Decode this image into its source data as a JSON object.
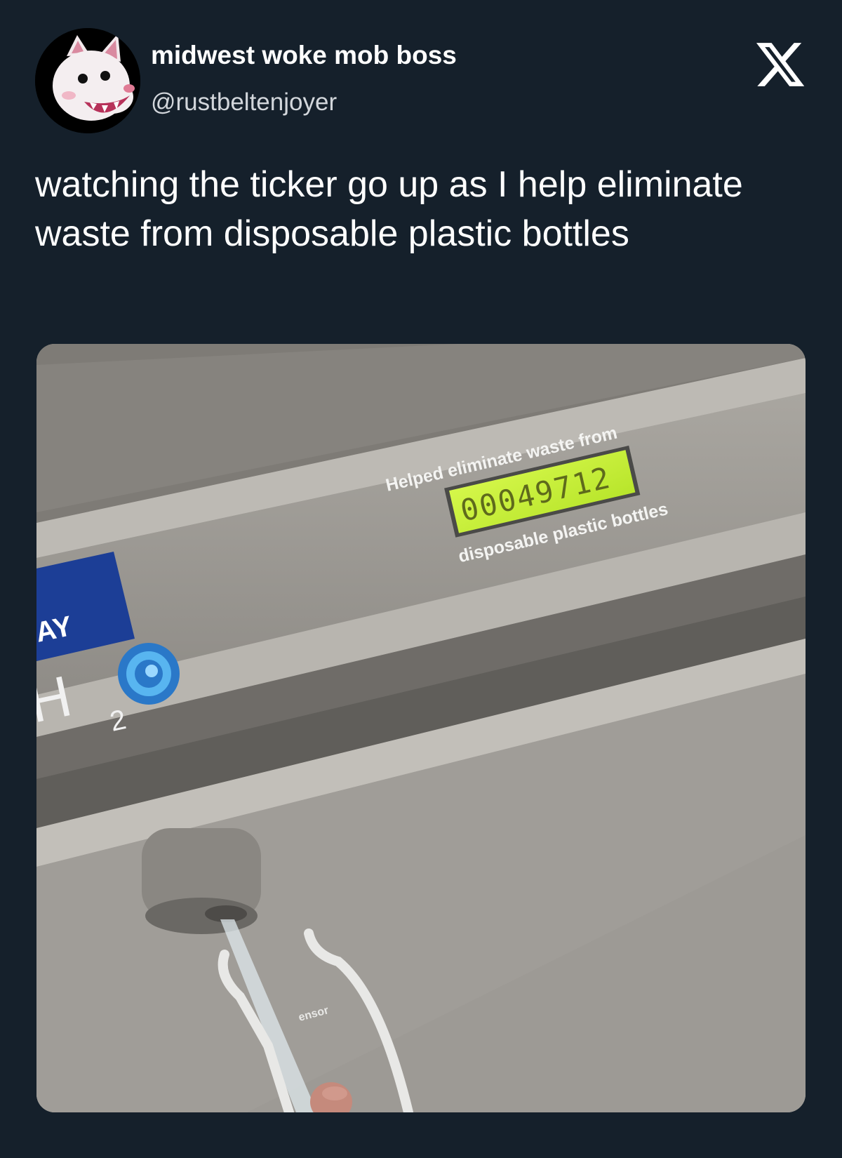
{
  "user": {
    "display_name": "midwest woke mob boss",
    "handle": "@rustbeltenjoyer",
    "avatar_icon": "opossum-avatar-icon"
  },
  "platform": {
    "logo_icon": "x-logo-icon"
  },
  "tweet": {
    "text": "watching the ticker go up as I help eliminate waste from disposable plastic bottles"
  },
  "media": {
    "panel_top_text": "Helped eliminate waste from",
    "counter_value": "00049712",
    "panel_bottom_text": "disposable plastic bottles",
    "brand_fragment": "AY",
    "h2o_label": "H",
    "h2o_subscript": "2",
    "sensor_label": "ensor",
    "lcd_color": "#c9f23a",
    "brand_blue": "#1c3e96"
  }
}
